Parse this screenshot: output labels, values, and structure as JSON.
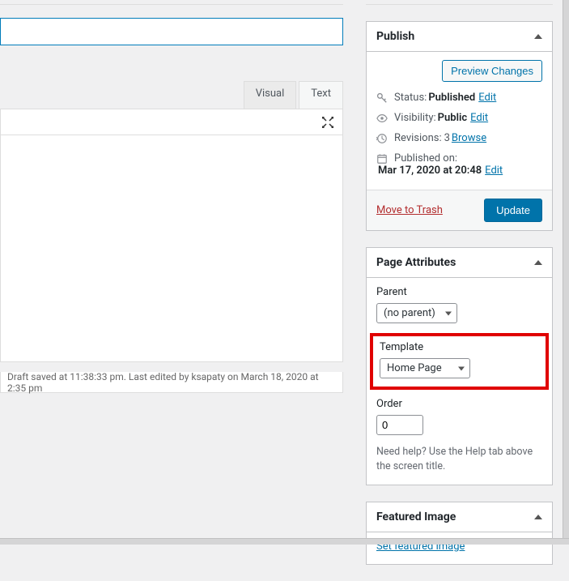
{
  "editor": {
    "title_value": "",
    "tabs": {
      "visual": "Visual",
      "text": "Text"
    },
    "status_text": "Draft saved at 11:38:33 pm. Last edited by ksapaty on March 18, 2020 at 2:35 pm"
  },
  "publish": {
    "heading": "Publish",
    "preview_btn": "Preview Changes",
    "status_label": "Status:",
    "status_value": "Published",
    "status_edit": "Edit",
    "visibility_label": "Visibility:",
    "visibility_value": "Public",
    "visibility_edit": "Edit",
    "revisions_label": "Revisions:",
    "revisions_value": "3",
    "revisions_browse": "Browse",
    "published_label": "Published on:",
    "published_value": "Mar 17, 2020 at 20:48",
    "published_edit": "Edit",
    "trash": "Move to Trash",
    "update_btn": "Update"
  },
  "attributes": {
    "heading": "Page Attributes",
    "parent_label": "Parent",
    "parent_value": "(no parent)",
    "template_label": "Template",
    "template_value": "Home Page",
    "order_label": "Order",
    "order_value": "0",
    "help_text": "Need help? Use the Help tab above the screen title."
  },
  "featured": {
    "heading": "Featured Image",
    "set_link": "Set featured image"
  }
}
